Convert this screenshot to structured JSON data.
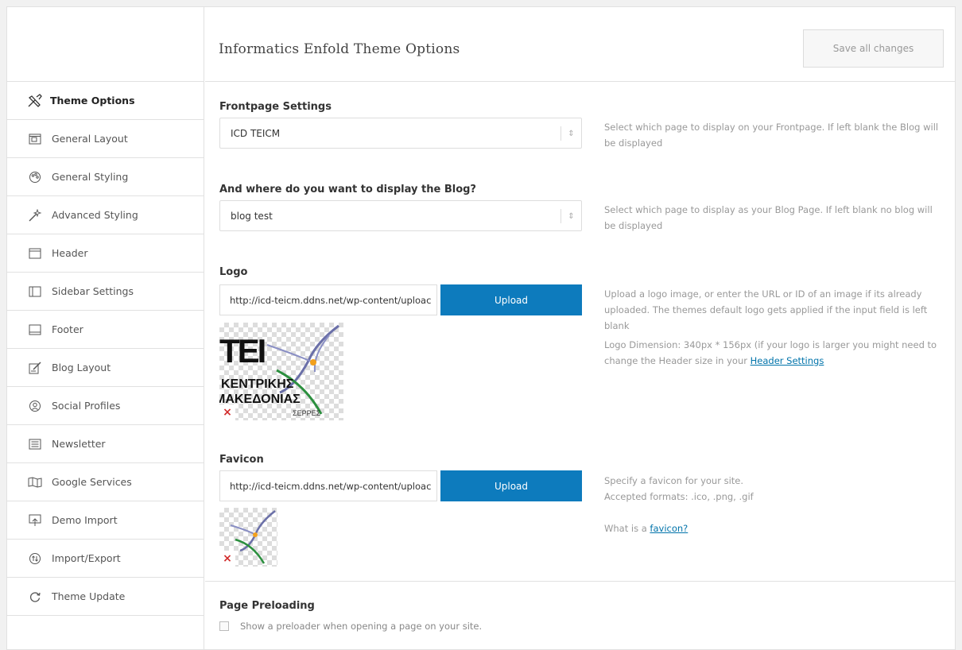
{
  "page": {
    "title": "Informatics Enfold Theme Options",
    "save_label": "Save all changes"
  },
  "sidebar": {
    "items": [
      {
        "label": "Theme Options",
        "icon": "tools-icon",
        "active": true
      },
      {
        "label": "General Layout",
        "icon": "layout-icon"
      },
      {
        "label": "General Styling",
        "icon": "palette-icon"
      },
      {
        "label": "Advanced Styling",
        "icon": "magic-wand-icon"
      },
      {
        "label": "Header",
        "icon": "header-icon"
      },
      {
        "label": "Sidebar Settings",
        "icon": "sidebar-icon"
      },
      {
        "label": "Footer",
        "icon": "footer-icon"
      },
      {
        "label": "Blog Layout",
        "icon": "edit-icon"
      },
      {
        "label": "Social Profiles",
        "icon": "social-icon"
      },
      {
        "label": "Newsletter",
        "icon": "newsletter-icon"
      },
      {
        "label": "Google Services",
        "icon": "map-icon"
      },
      {
        "label": "Demo Import",
        "icon": "import-icon"
      },
      {
        "label": "Import/Export",
        "icon": "import-export-icon"
      },
      {
        "label": "Theme Update",
        "icon": "refresh-icon"
      }
    ]
  },
  "frontpage": {
    "label": "Frontpage Settings",
    "value": "ICD TEICM",
    "desc": "Select which page to display on your Frontpage. If left blank the Blog will be displayed"
  },
  "blog": {
    "label": "And where do you want to display the Blog?",
    "value": "blog test",
    "desc": "Select which page to display as your Blog Page. If left blank no blog will be displayed"
  },
  "logo": {
    "label": "Logo",
    "value": "http://icd-teicm.ddns.net/wp-content/uploac",
    "upload_label": "Upload",
    "desc1": "Upload a logo image, or enter the URL or ID of an image if its already uploaded. The themes default logo gets applied if the input field is left blank",
    "desc2_prefix": "Logo Dimension: 340px * 156px (if your logo is larger you might need to change the Header size in your ",
    "desc2_link": "Header Settings",
    "logo_text_1": "TEI",
    "logo_text_2": "ΚΕΝΤΡΙΚΗΣ",
    "logo_text_3": "ΜΑΚΕΔΟΝΙΑΣ",
    "logo_text_4": "ΣΕΡΡΕΣ",
    "remove": "×"
  },
  "favicon": {
    "label": "Favicon",
    "value": "http://icd-teicm.ddns.net/wp-content/uploac",
    "upload_label": "Upload",
    "desc1": "Specify a favicon for your site.",
    "desc2": "Accepted formats: .ico, .png, .gif",
    "desc3_prefix": "What is a ",
    "desc3_link": "favicon?",
    "remove": "×"
  },
  "preloading": {
    "label": "Page Preloading",
    "checkbox_label": "Show a preloader when opening a page on your site."
  },
  "colors": {
    "upload": "#0d7bbd",
    "remove": "#d12b2b"
  }
}
